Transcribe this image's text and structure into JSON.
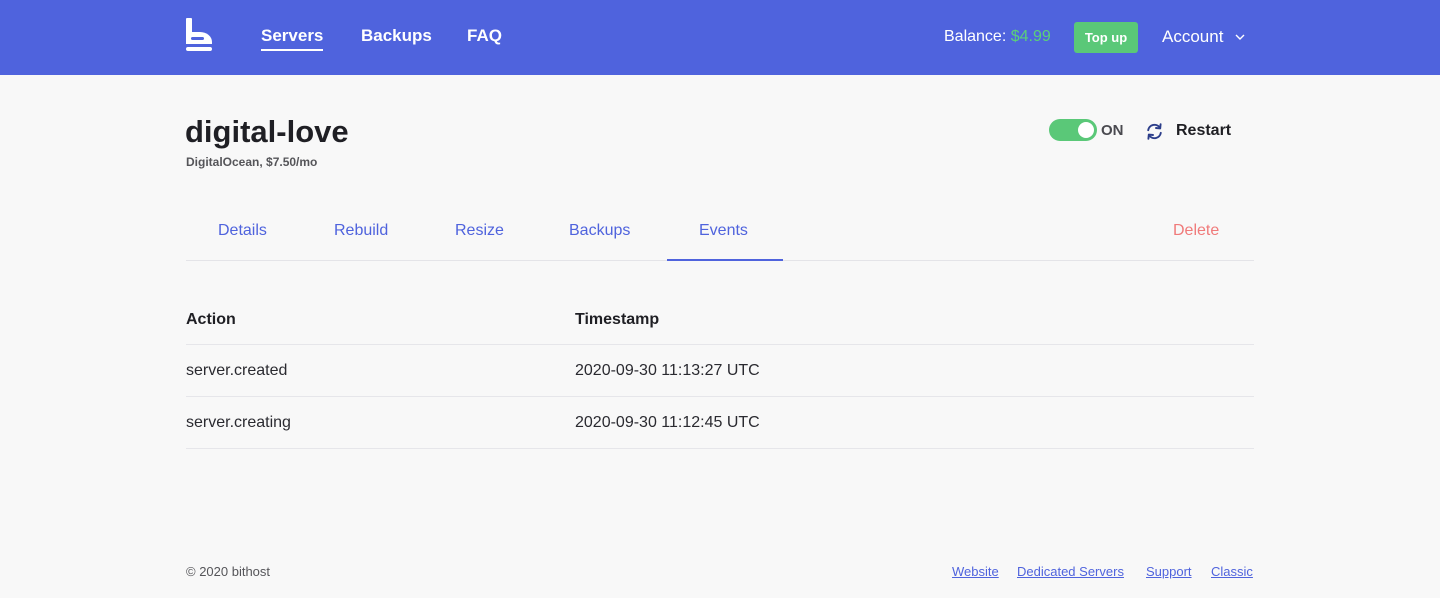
{
  "header": {
    "nav": [
      {
        "label": "Servers",
        "active": true
      },
      {
        "label": "Backups",
        "active": false
      },
      {
        "label": "FAQ",
        "active": false
      }
    ],
    "balance_label": "Balance: ",
    "balance_amount": "$4.99",
    "topup_label": "Top up",
    "account_label": "Account"
  },
  "server": {
    "name": "digital-love",
    "subtitle": "DigitalOcean, $7.50/mo",
    "power_state": "ON",
    "restart_label": "Restart"
  },
  "tabs": [
    {
      "label": "Details"
    },
    {
      "label": "Rebuild"
    },
    {
      "label": "Resize"
    },
    {
      "label": "Backups"
    },
    {
      "label": "Events",
      "active": true
    },
    {
      "label": "Delete"
    }
  ],
  "events_table": {
    "columns": [
      "Action",
      "Timestamp"
    ],
    "rows": [
      {
        "action": "server.created",
        "timestamp": "2020-09-30 11:13:27 UTC"
      },
      {
        "action": "server.creating",
        "timestamp": "2020-09-30 11:12:45 UTC"
      }
    ]
  },
  "footer": {
    "copyright": "© 2020 bithost",
    "links": [
      "Website",
      "Dedicated Servers",
      "Support",
      "Classic"
    ]
  },
  "colors": {
    "brand": "#4f63dd",
    "success": "#5ac878",
    "danger": "#f07a7a"
  },
  "icons": [
    "bithost-logo-icon",
    "chevron-down-icon",
    "refresh-icon"
  ]
}
